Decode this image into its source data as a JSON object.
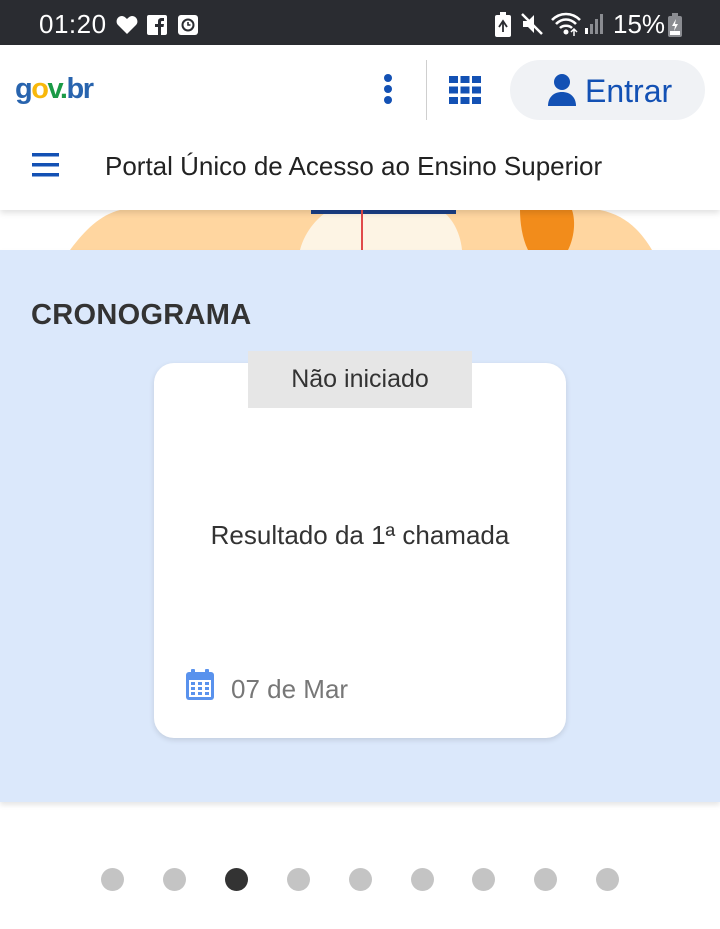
{
  "status_bar": {
    "time": "01:20",
    "battery": "15%",
    "icons": [
      "heart-icon",
      "facebook-icon",
      "clock-app-icon",
      "battery-saver-icon",
      "mute-icon",
      "wifi-icon",
      "signal-icon",
      "battery-icon"
    ]
  },
  "header": {
    "logo": {
      "g": "g",
      "o": "o",
      "v": "v",
      "dot": ".",
      "br": "br"
    },
    "login_label": "Entrar",
    "portal_title": "Portal Único de Acesso ao Ensino Superior",
    "colors": {
      "primary": "#1351b4",
      "logo_blue": "#2864ae",
      "logo_yellow": "#f8b80b",
      "logo_green": "#1b9a46"
    }
  },
  "cronograma": {
    "title": "CRONOGRAMA",
    "background": "#dbe8fb",
    "card": {
      "status": "Não iniciado",
      "event": "Resultado da 1ª chamada",
      "date": "07 de Mar"
    }
  },
  "carousel": {
    "total": 9,
    "active_index": 2
  }
}
